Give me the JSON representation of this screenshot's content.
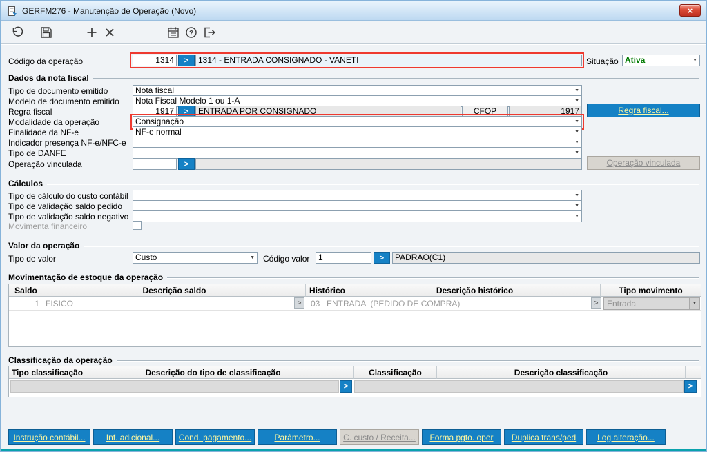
{
  "icons": {
    "close": "×",
    "dropdown_arrow": "▼",
    "chevron_right": ">",
    "toolbar": [
      "undo-icon",
      "save-icon",
      "add-icon",
      "delete-icon",
      "calendar-icon",
      "help-icon",
      "exit-icon"
    ]
  },
  "colors": {
    "accent_blue": "#1581c5",
    "alert_red": "#ee3a30",
    "active_green": "#007a00",
    "button_text_yellow": "#fdf7a0"
  },
  "window": {
    "title": "GERFM276 - Manutenção de Operação (Novo)"
  },
  "header": {
    "codigo_label": "Código da operação",
    "codigo_value": "1314",
    "codigo_desc": "1314 - ENTRADA CONSIGNADO - VANETI",
    "situacao_label": "Situação",
    "situacao_value": "Ativa"
  },
  "nota_fiscal": {
    "title": "Dados da nota fiscal",
    "tipo_documento": {
      "label": "Tipo de documento emitido",
      "value": "Nota fiscal"
    },
    "modelo_documento": {
      "label": "Modelo de documento emitido",
      "value": "Nota Fiscal Modelo 1 ou 1-A"
    },
    "regra_fiscal": {
      "label": "Regra fiscal",
      "codigo": "1917",
      "descricao": "ENTRADA POR CONSIGNADO",
      "cfop_label": "CFOP",
      "cfop_value": "1917",
      "button": "Regra fiscal..."
    },
    "modalidade": {
      "label": "Modalidade da operação",
      "value": "Consignação"
    },
    "finalidade": {
      "label": "Finalidade da NF-e",
      "value": "NF-e normal"
    },
    "indicador": {
      "label": "Indicador presença NF-e/NFC-e",
      "value": ""
    },
    "tipo_danfe": {
      "label": "Tipo de DANFE",
      "value": ""
    },
    "operacao_vinculada": {
      "label": "Operação vinculada",
      "codigo": "",
      "descricao": "",
      "button": "Operação vinculada"
    }
  },
  "calculos": {
    "title": "Cálculos",
    "custo_contabil_label": "Tipo de cálculo do custo contábil",
    "saldo_pedido_label": "Tipo de validação saldo pedido",
    "saldo_negativo_label": "Tipo de validação saldo negativo",
    "movimenta_financeiro_label": "Movimenta financeiro"
  },
  "valor_operacao": {
    "title": "Valor da operação",
    "tipo_valor_label": "Tipo de valor",
    "tipo_valor_value": "Custo",
    "codigo_valor_label": "Código valor",
    "codigo_valor_value": "1",
    "codigo_valor_desc": "PADRAO(C1)"
  },
  "estoque": {
    "title": "Movimentação de estoque da operação",
    "headers": [
      "Saldo",
      "Descrição saldo",
      "Histórico",
      "Descrição histórico",
      "Tipo movimento"
    ],
    "row": {
      "saldo": "1",
      "descricao_saldo": "FISICO",
      "historico": "03",
      "descricao_historico": "ENTRADA  (PEDIDO DE COMPRA)",
      "tipo_movimento": "Entrada"
    }
  },
  "classificacao": {
    "title": "Classificação da operação",
    "headers": [
      "Tipo classificação",
      "Descrição do tipo de classificação",
      "Classificação",
      "Descrição classificação"
    ]
  },
  "footer": {
    "buttons": [
      {
        "label": "Instrução contábil...",
        "enabled": true
      },
      {
        "label": "Inf. adicional...",
        "enabled": true
      },
      {
        "label": "Cond. pagamento...",
        "enabled": true
      },
      {
        "label": "Parâmetro...",
        "enabled": true
      },
      {
        "label": "C. custo / Receita...",
        "enabled": false
      },
      {
        "label": "Forma pgto. oper",
        "enabled": true
      },
      {
        "label": "Duplica trans/ped",
        "enabled": true
      },
      {
        "label": "Log alteração...",
        "enabled": true
      }
    ]
  }
}
